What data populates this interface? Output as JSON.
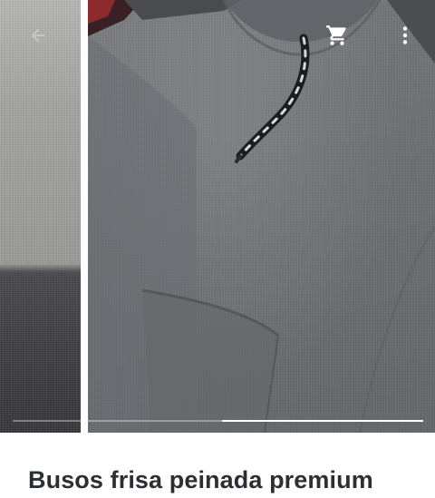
{
  "header": {
    "back_icon": "arrow-back-icon",
    "cart_icon": "shopping-cart-icon",
    "more_icon": "more-vert-icon",
    "icon_color": "#ffffff"
  },
  "gallery": {
    "current_image": 2,
    "total_images": 2,
    "indicator_color": "#ffffff"
  },
  "product": {
    "title": "Busos frisa peinada premium"
  },
  "colors": {
    "title": "#2b2f33",
    "background": "#ffffff"
  }
}
